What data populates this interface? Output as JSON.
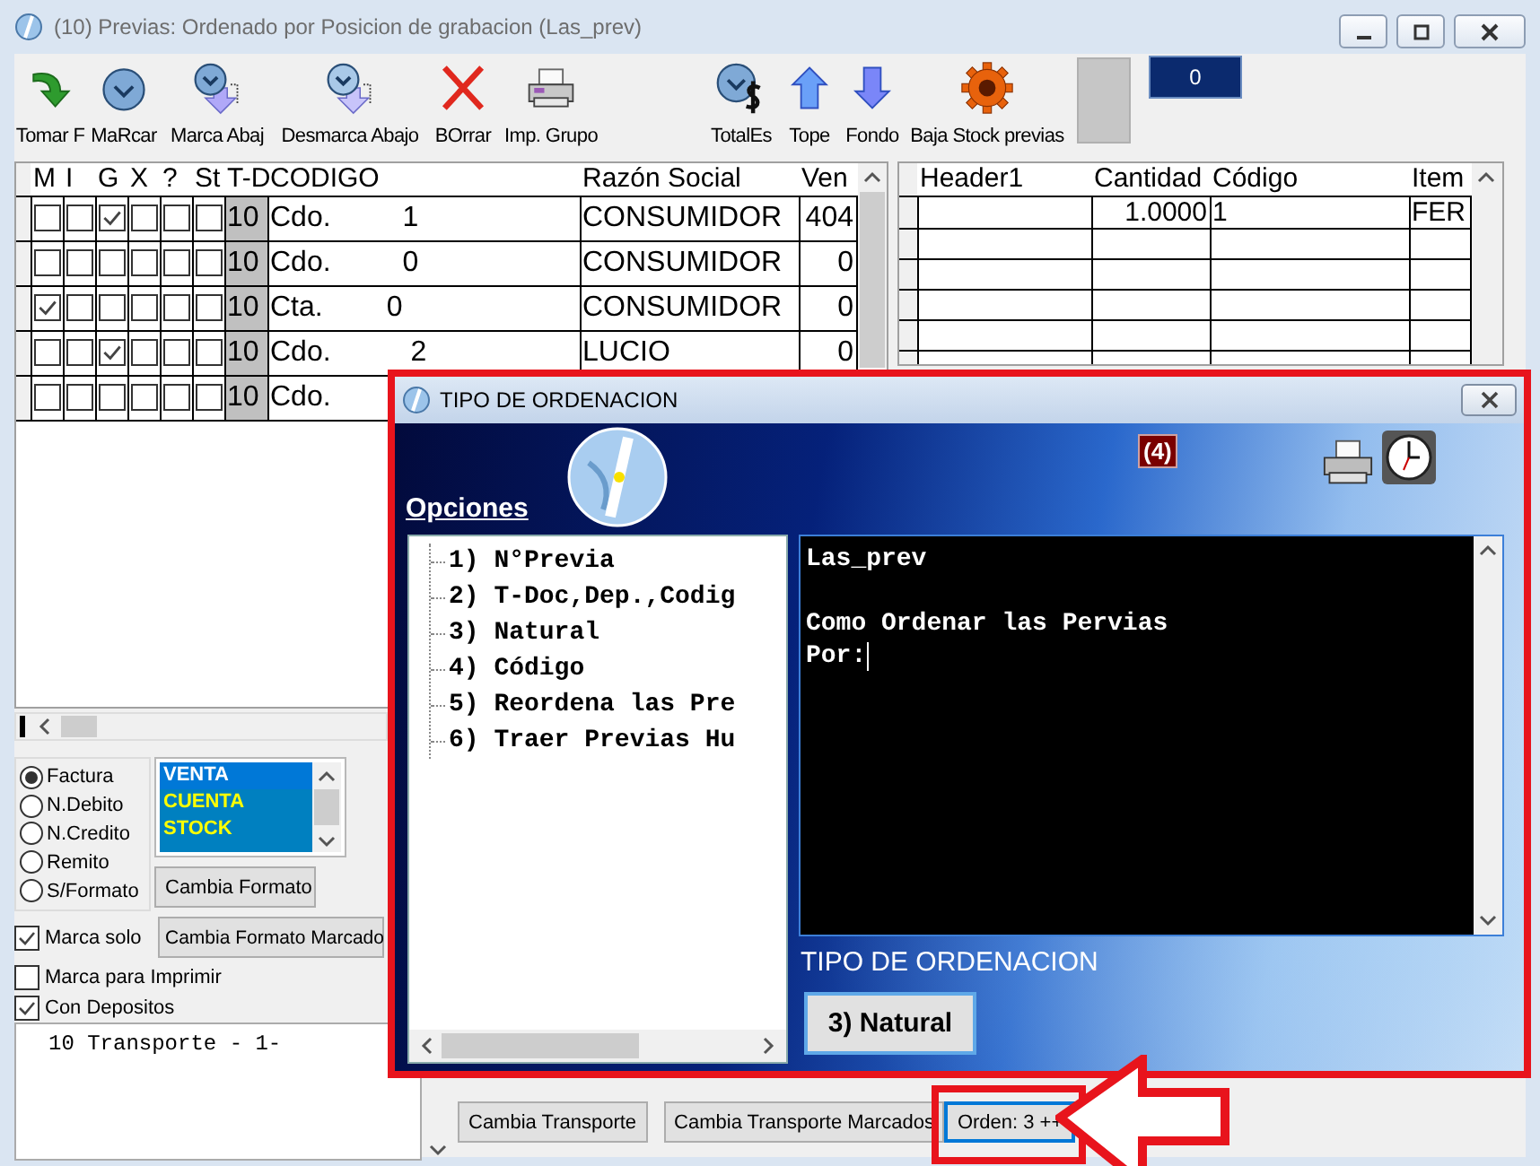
{
  "window": {
    "title": "(10) Previas: Ordenado por Posicion de grabacion (Las_prev)"
  },
  "toolbar": [
    {
      "label": "Tomar F"
    },
    {
      "label": "MaRcar"
    },
    {
      "label": "Marca Abaj"
    },
    {
      "label": "Desmarca Abajo"
    },
    {
      "label": "BOrrar"
    },
    {
      "label": "Imp. Grupo"
    },
    {
      "label": "TotalEs"
    },
    {
      "label": "Tope"
    },
    {
      "label": "Fondo"
    },
    {
      "label": "Baja Stock previas"
    }
  ],
  "counter": "0",
  "left_table": {
    "columns": [
      "M",
      "I",
      "G",
      "X",
      "?",
      "St",
      "T-D",
      "CODIGO",
      "Razón Social",
      "Ven"
    ],
    "rows": [
      {
        "flags": [
          false,
          false,
          true,
          false,
          false,
          false
        ],
        "t_d": "10",
        "codigo": "Cdo.         1",
        "razon": "CONSUMIDOR",
        "vend": "404"
      },
      {
        "flags": [
          false,
          false,
          false,
          false,
          false,
          false
        ],
        "t_d": "10",
        "codigo": "Cdo.         0",
        "razon": "CONSUMIDOR",
        "vend": "0"
      },
      {
        "flags": [
          true,
          false,
          false,
          false,
          false,
          false
        ],
        "t_d": "10",
        "codigo": "Cta.        0",
        "razon": "CONSUMIDOR",
        "vend": "0"
      },
      {
        "flags": [
          false,
          false,
          true,
          false,
          false,
          false
        ],
        "t_d": "10",
        "codigo": "Cdo.          2",
        "razon": "LUCIO",
        "vend": "0"
      },
      {
        "flags": [
          false,
          false,
          false,
          false,
          false,
          false
        ],
        "t_d": "10",
        "codigo": "Cdo."
      }
    ]
  },
  "right_table": {
    "columns": [
      "Header1",
      "Cantidad",
      "Código",
      "Item"
    ],
    "rows": [
      {
        "cantidad": "1.0000",
        "codigo": "1",
        "item": "FER"
      }
    ]
  },
  "doc_types": [
    {
      "label": "Factura",
      "selected": true
    },
    {
      "label": "N.Debito",
      "selected": false
    },
    {
      "label": "N.Credito",
      "selected": false
    },
    {
      "label": "Remito",
      "selected": false
    },
    {
      "label": "S/Formato",
      "selected": false
    }
  ],
  "formats": [
    {
      "label": "VENTA",
      "selected": true
    },
    {
      "label": "CUENTA",
      "selected": false
    },
    {
      "label": "STOCK",
      "selected": false
    }
  ],
  "format_button": "Cambia Formato",
  "format_marked_button": "Cambia Formato Marcado",
  "options": [
    {
      "label": "Marca solo",
      "checked": true
    },
    {
      "label": "Marca para Imprimir",
      "checked": false
    },
    {
      "label": "Con Depositos",
      "checked": true
    }
  ],
  "transport_text": "10 Transporte - 1-",
  "bottom_buttons": [
    {
      "label": "Cambia Transporte",
      "focused": false
    },
    {
      "label": "Cambia Transporte Marcados",
      "focused": false
    },
    {
      "label": "Orden: 3 ++",
      "focused": true
    }
  ],
  "dialog": {
    "title": "TIPO DE ORDENACION",
    "options_label": "Opciones",
    "badge": "(4)",
    "tree": [
      "1) N°Previa",
      "2) T-Doc,Dep.,Codig",
      "3) Natural",
      "4) Código",
      "5) Reordena las Pre",
      "6) Traer Previas Hu"
    ],
    "console": {
      "heading": "Las_prev",
      "lines": [
        "Como Ordenar las Pervias",
        "Por:"
      ]
    },
    "caption": "TIPO DE ORDENACION",
    "action_button": "3) Natural"
  }
}
